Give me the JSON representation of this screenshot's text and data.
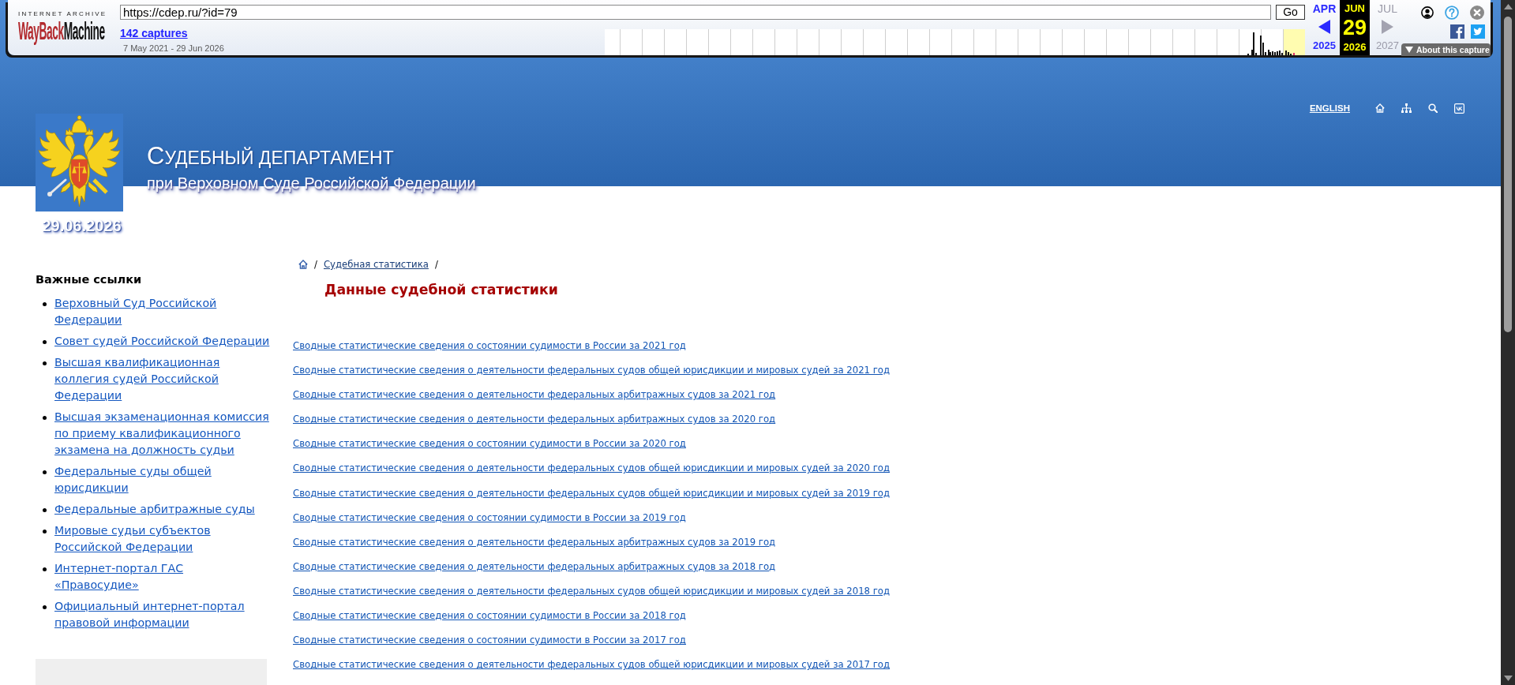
{
  "wayback_toolbar": {
    "logo_caption": "INTERNET ARCHIVE",
    "logo_word_1": "WayBack",
    "logo_word_2": "Machine",
    "url": "https://cdep.ru/?id=79",
    "go_button": "Go",
    "captures_link": "142 captures",
    "date_range": "7 May 2021 - 29 Jun 2026",
    "calendar": [
      {
        "kind": "prev",
        "month": "APR",
        "year": "2025",
        "disabled": false
      },
      {
        "kind": "current",
        "month": "JUN",
        "day": "29",
        "year": "2026",
        "disabled": false
      },
      {
        "kind": "next",
        "month": "JUL",
        "year": "2027",
        "disabled": true
      }
    ],
    "about_button": "About this capture"
  },
  "header": {
    "title": "СУДЕБНЫЙ ДЕПАРТАМЕНТ",
    "subtitle": "при Верховном Суде Российской Федерации",
    "date": "29.06.2026",
    "language_link": "ENGLISH"
  },
  "sidebar": {
    "heading": "Важные ссылки",
    "links": [
      "Верховный Суд Российской Федерации",
      "Совет судей Российской Федерации",
      "Высшая квалификационная коллегия судей Российской Федерации",
      "Высшая экзаменационная комиссия по приему квалификационного экзамена на должность судьи",
      "Федеральные суды общей юрисдикции",
      "Федеральные арбитражные суды",
      "Мировые судьи субъектов Российской Федерации",
      "Интернет-портал ГАС «Правосудие»",
      "Официальный интернет-портал правовой информации"
    ]
  },
  "breadcrumb": [
    {
      "kind": "home"
    },
    {
      "kind": "separator",
      "text": "/"
    },
    {
      "kind": "link",
      "text": "Судебная статистика"
    },
    {
      "kind": "separator",
      "text": "/"
    }
  ],
  "page_title": "Данные судебной статистики",
  "document_links": [
    "Сводные статистические сведения о состоянии судимости в России за 2021 год",
    "Сводные статистические сведения о деятельности федеральных судов общей юрисдикции и мировых судей за 2021 год",
    "Сводные статистические сведения о деятельности федеральных арбитражных судов за 2021 год",
    "Сводные статистические сведения о деятельности федеральных арбитражных судов за 2020 год",
    "Сводные статистические сведения о состоянии судимости в России за 2020 год",
    "Сводные статистические сведения о деятельности федеральных судов общей юрисдикции и мировых судей за 2020 год",
    "Сводные статистические сведения о деятельности федеральных судов общей юрисдикции и мировых судей за 2019 год",
    "Сводные статистические сведения о состоянии судимости в России за 2019 год",
    "Сводные статистические сведения о деятельности федеральных арбитражных судов за 2019 год",
    "Сводные статистические сведения о деятельности федеральных арбитражных судов за 2018 год",
    "Сводные статистические сведения о деятельности федеральных судов общей юрисдикции и мировых судей за 2018 год",
    "Сводные статистические сведения о состоянии судимости в России за 2018 год",
    "Сводные статистические сведения о состоянии судимости в России за 2017 год",
    "Сводные статистические сведения о деятельности федеральных судов общей юрисдикции и мировых судей за 2017 год"
  ]
}
